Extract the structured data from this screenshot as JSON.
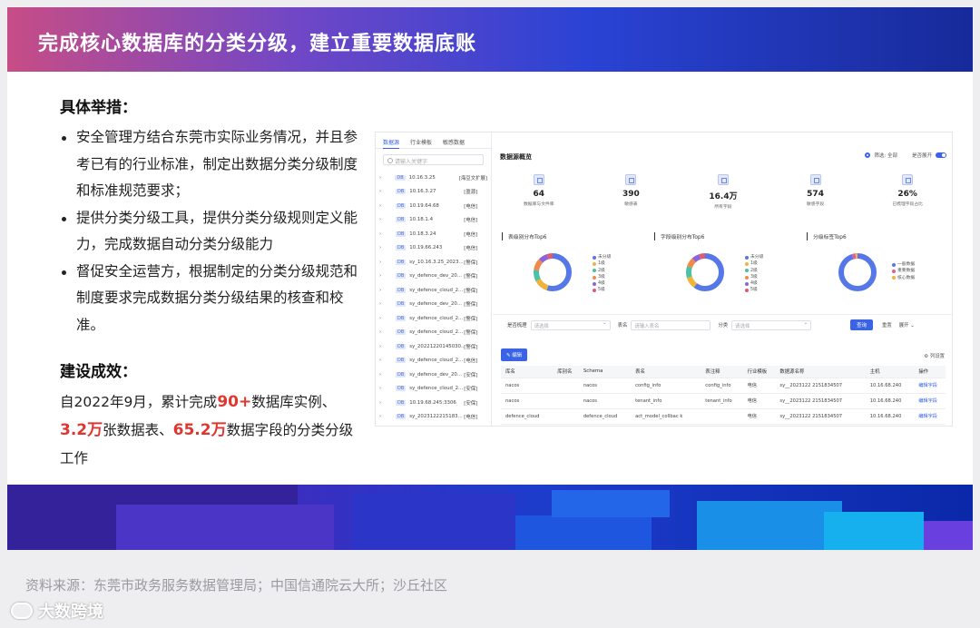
{
  "slide": {
    "title": "完成核心数据库的分类分级，建立重要数据底账",
    "measures_heading": "具体举措：",
    "bullets": [
      "安全管理方结合东莞市实际业务情况，并且参考已有的行业标准，制定出数据分类分级制度和标准规范要求；",
      "提供分类分级工具，提供分类分级规则定义能力，完成数据自动分类分级能力",
      "督促安全运营方，根据制定的分类分级规范和制度要求完成数据分类分级结果的核查和校准。"
    ],
    "results_heading": "建设成效：",
    "results": {
      "p1": "自2022年9月，累计完成",
      "h1": "90+",
      "p2": "数据库实例、",
      "h2": "3.2万",
      "p3": "张数据表、",
      "h3": "65.2万",
      "p4": "数据字段的分类分级工作"
    },
    "source": "资料来源：东莞市政务服务数据管理局；中国信通院云大所；沙丘社区",
    "watermark": "大数跨境"
  },
  "screenshot": {
    "tabs": [
      "数据源",
      "行业模板",
      "敏感数据"
    ],
    "search_placeholder": "请输入关键字",
    "tree_prefix": "DB",
    "tree": [
      {
        "name": "10.16.3.25",
        "tag": "[海豆文扩展]"
      },
      {
        "name": "10.16.3.27",
        "tag": "[盈源]"
      },
      {
        "name": "10.19.64.68",
        "tag": "[电信]"
      },
      {
        "name": "10.18.1.4",
        "tag": "[电信]"
      },
      {
        "name": "10.18.3.24",
        "tag": "[电信]"
      },
      {
        "name": "10.19.66.243",
        "tag": "[电信]"
      },
      {
        "name": "sy_10.16.3.25_2023...",
        "tag": "[警保]"
      },
      {
        "name": "sy_defence_dev_20...",
        "tag": "[警保]"
      },
      {
        "name": "sy_defence_cloud_2...",
        "tag": "[警保]"
      },
      {
        "name": "sy_defence_dev_20...",
        "tag": "[警保]"
      },
      {
        "name": "sy_defence_cloud_2...",
        "tag": "[警保]"
      },
      {
        "name": "sy_defence_cloud_2...",
        "tag": "[警保]"
      },
      {
        "name": "sy_20221220145030...",
        "tag": "[警保]"
      },
      {
        "name": "sy_defence_cloud_2...",
        "tag": "[电信]"
      },
      {
        "name": "sy_defence_dev_20...",
        "tag": "[安保]"
      },
      {
        "name": "sy_defence_cloud_2...",
        "tag": "[安保]"
      },
      {
        "name": "10.19.68.245:3306",
        "tag": "[安保]"
      },
      {
        "name": "sy_2023122215183...",
        "tag": "[电信]"
      }
    ],
    "panel_title": "数据源概览",
    "option_radio": "筛选: 全部",
    "option_toggle": "是否展开",
    "stats": [
      {
        "value": "64",
        "label": "数据库与文件库"
      },
      {
        "value": "390",
        "label": "敏感表"
      },
      {
        "value": "16.4万",
        "label": "所有字段"
      },
      {
        "value": "574",
        "label": "敏感字段"
      },
      {
        "value": "26%",
        "label": "已梳理字段占比"
      }
    ],
    "charts": [
      {
        "title": "表级别分布Top6",
        "legend": [
          "未分级",
          "1级",
          "2级",
          "3级",
          "4级",
          "5级"
        ]
      },
      {
        "title": "字段级别分布Top6",
        "legend": [
          "未分级",
          "1级",
          "2级",
          "3级",
          "4级",
          "5级"
        ]
      },
      {
        "title": "分级标签Top6",
        "legend": [
          "一般数据",
          "重要数据",
          "核心数据"
        ]
      }
    ],
    "chart_data": [
      {
        "type": "pie",
        "title": "表级别分布Top6",
        "categories": [
          "未分级",
          "1级",
          "2级",
          "3级",
          "4级",
          "5级"
        ],
        "values": [
          55,
          12,
          10,
          10,
          8,
          5
        ]
      },
      {
        "type": "pie",
        "title": "字段级别分布Top6",
        "categories": [
          "未分级",
          "1级",
          "2级",
          "3级",
          "4级",
          "5级"
        ],
        "values": [
          60,
          10,
          10,
          8,
          7,
          5
        ]
      },
      {
        "type": "pie",
        "title": "分级标签Top6",
        "categories": [
          "一般数据",
          "重要数据",
          "核心数据"
        ],
        "values": [
          95,
          3,
          2
        ]
      }
    ],
    "level_colors": [
      "#5677e8",
      "#f2b33b",
      "#4cc1a4",
      "#f08a4b",
      "#8c64d8",
      "#e05b6e"
    ],
    "tag_colors": [
      "#5677e8",
      "#e25b9a",
      "#f2b33b"
    ],
    "filter": {
      "l1": "是否梳理",
      "p1": "请选择",
      "l2": "表名",
      "p2": "请输入表名",
      "l3": "分类",
      "p3": "请选择",
      "query": "查询",
      "reset": "重置",
      "expand": "展开 ⌄"
    },
    "edit_button": "编辑",
    "column_settings": "⚙ 列设置",
    "columns": [
      "库名",
      "库别名",
      "Schema",
      "表名",
      "表注释",
      "行业模板",
      "数据源名称",
      "主机",
      "操作"
    ],
    "rows": [
      [
        "nacos",
        "",
        "nacos",
        "config_info",
        "config_info",
        "电信",
        "sy__2023122 2151834507",
        "10.16.68.240",
        "编辑字段"
      ],
      [
        "nacos",
        "",
        "nacos",
        "tenant_info",
        "tenant_info",
        "电信",
        "sy__2023122 2151834507",
        "10.16.68.240",
        "编辑字段"
      ],
      [
        "defence_cloud",
        "",
        "defence_cloud",
        "act_model_collbac k",
        "",
        "电信",
        "sy__2023122 2151834507",
        "10.16.68.240",
        "编辑字段"
      ]
    ]
  }
}
